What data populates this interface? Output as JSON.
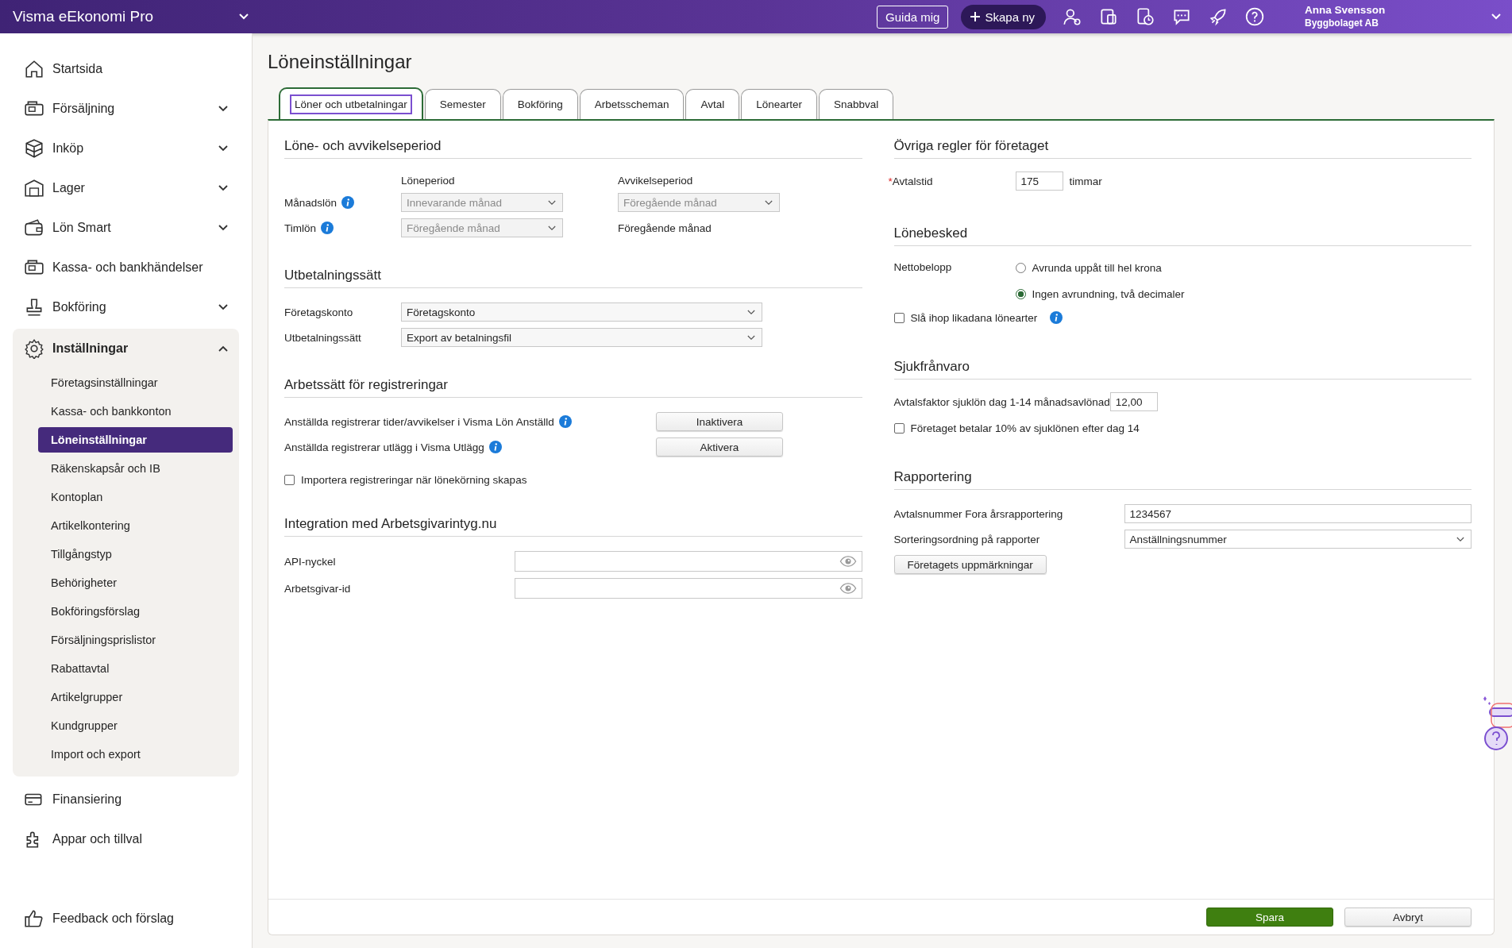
{
  "topbar": {
    "product": "Visma eEkonomi Pro",
    "guide_button": "Guida mig",
    "create_button": "Skapa ny",
    "user_name": "Anna Svensson",
    "company": "Byggbolaget AB"
  },
  "sidebar": {
    "items": [
      {
        "label": "Startsida",
        "expandable": false
      },
      {
        "label": "Försäljning",
        "expandable": true,
        "expanded": false
      },
      {
        "label": "Inköp",
        "expandable": true,
        "expanded": false
      },
      {
        "label": "Lager",
        "expandable": true,
        "expanded": false
      },
      {
        "label": "Lön Smart",
        "expandable": true,
        "expanded": false
      },
      {
        "label": "Kassa- och bankhändelser",
        "expandable": false
      },
      {
        "label": "Bokföring",
        "expandable": true,
        "expanded": false
      },
      {
        "label": "Inställningar",
        "expandable": true,
        "expanded": true,
        "children": [
          {
            "label": "Företagsinställningar",
            "selected": false
          },
          {
            "label": "Kassa- och bankkonton",
            "selected": false
          },
          {
            "label": "Löneinställningar",
            "selected": true
          },
          {
            "label": "Räkenskapsår och IB",
            "selected": false
          },
          {
            "label": "Kontoplan",
            "selected": false
          },
          {
            "label": "Artikelkontering",
            "selected": false
          },
          {
            "label": "Tillgångstyp",
            "selected": false
          },
          {
            "label": "Behörigheter",
            "selected": false
          },
          {
            "label": "Bokföringsförslag",
            "selected": false
          },
          {
            "label": "Försäljningsprislistor",
            "selected": false
          },
          {
            "label": "Rabattavtal",
            "selected": false
          },
          {
            "label": "Artikelgrupper",
            "selected": false
          },
          {
            "label": "Kundgrupper",
            "selected": false
          },
          {
            "label": "Import och export",
            "selected": false
          }
        ]
      },
      {
        "label": "Finansiering",
        "expandable": false
      },
      {
        "label": "Appar och tillval",
        "expandable": false
      }
    ],
    "feedback": "Feedback och förslag"
  },
  "page_title": "Löneinställningar",
  "tabs": [
    {
      "label": "Löner och utbetalningar",
      "selected": true
    },
    {
      "label": "Semester",
      "selected": false
    },
    {
      "label": "Bokföring",
      "selected": false
    },
    {
      "label": "Arbetsscheman",
      "selected": false
    },
    {
      "label": "Avtal",
      "selected": false
    },
    {
      "label": "Lönearter",
      "selected": false
    },
    {
      "label": "Snabbval",
      "selected": false
    }
  ],
  "pay_period": {
    "heading": "Löne- och avvikelseperiod",
    "col_pay": "Löneperiod",
    "col_deviation": "Avvikelseperiod",
    "rows": [
      {
        "label": "Månadslön",
        "info": true,
        "pay": {
          "value": "Innevarande månad",
          "disabled": true
        },
        "deviation": {
          "kind": "select",
          "value": "Föregående månad",
          "disabled": true
        }
      },
      {
        "label": "Timlön",
        "info": true,
        "pay": {
          "value": "Föregående månad",
          "disabled": true
        },
        "deviation": {
          "kind": "text",
          "value": "Föregående månad"
        }
      }
    ]
  },
  "payout": {
    "heading": "Utbetalningssätt",
    "fields": [
      {
        "label": "Företagskonto",
        "value": "Företagskonto",
        "disabled": false
      },
      {
        "label": "Utbetalningssätt",
        "value": "Export av betalningsfil",
        "disabled": false
      }
    ]
  },
  "registration": {
    "heading": "Arbetssätt för registreringar",
    "rows": [
      {
        "label": "Anställda registrerar tider/avvikelser i Visma Lön Anställd",
        "info": true,
        "button": "Inaktivera"
      },
      {
        "label": "Anställda registrerar utlägg i Visma Utlägg",
        "info": true,
        "button": "Aktivera"
      }
    ],
    "checkbox": {
      "label": "Importera registreringar när lönekörning skapas",
      "checked": false
    }
  },
  "integration": {
    "heading": "Integration med Arbetsgivarintyg.nu",
    "fields": [
      {
        "label": "API-nyckel"
      },
      {
        "label": "Arbetsgivar-id"
      }
    ]
  },
  "other_rules": {
    "heading": "Övriga regler för företaget",
    "label": "Avtalstid",
    "required_mark": "*",
    "value": "175",
    "unit": "timmar"
  },
  "payslip": {
    "heading": "Lönebesked",
    "label": "Nettobelopp",
    "options": [
      {
        "label": "Avrunda uppåt till hel krona",
        "selected": false
      },
      {
        "label": "Ingen avrundning, två decimaler",
        "selected": true
      }
    ],
    "checkbox": {
      "label": "Slå ihop likadana lönearter",
      "checked": false,
      "info": true
    }
  },
  "sick": {
    "heading": "Sjukfrånvaro",
    "factor_label": "Avtalsfaktor sjuklön dag 1-14 månadsavlönad",
    "factor_value": "12,00",
    "checkbox": {
      "label": "Företaget betalar 10% av sjuklönen efter dag 14",
      "checked": false
    }
  },
  "reporting": {
    "heading": "Rapportering",
    "number_label": "Avtalsnummer Fora årsrapportering",
    "number_value": "1234567",
    "sort_label": "Sorteringsordning på rapporter",
    "sort_value": "Anställningsnummer",
    "tags_button": "Företagets uppmärkningar"
  },
  "footer": {
    "save": "Spara",
    "cancel": "Avbryt"
  }
}
